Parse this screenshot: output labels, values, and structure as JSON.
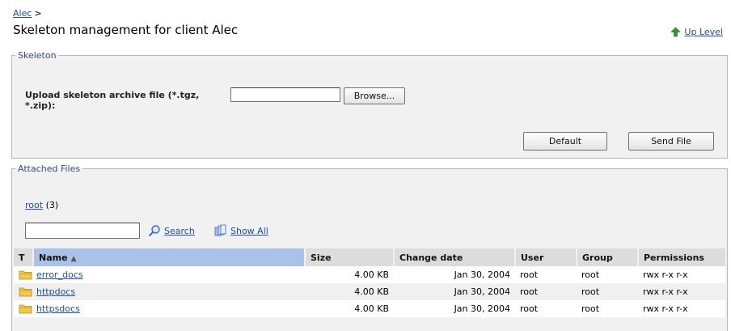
{
  "breadcrumb": {
    "link": "Alec",
    "separator": ">"
  },
  "page_title": "Skeleton management for client Alec",
  "up_level_label": "Up Level",
  "skeleton": {
    "legend": "Skeleton",
    "upload_label": "Upload skeleton archive file (*.tgz, *.zip):",
    "file_value": "",
    "browse_label": "Browse...",
    "default_label": "Default",
    "send_file_label": "Send File"
  },
  "attached": {
    "legend": "Attached Files",
    "root_link": "root",
    "root_count": "(3)",
    "search_value": "",
    "search_label": "Search",
    "show_all_label": "Show All",
    "columns": {
      "type": "T",
      "name": "Name",
      "size": "Size",
      "change_date": "Change date",
      "user": "User",
      "group": "Group",
      "permissions": "Permissions"
    },
    "rows": [
      {
        "name": "error_docs",
        "size": "4.00 KB",
        "date": "Jan 30, 2004",
        "user": "root",
        "group": "root",
        "perms": "rwx r-x r-x"
      },
      {
        "name": "httpdocs",
        "size": "4.00 KB",
        "date": "Jan 30, 2004",
        "user": "root",
        "group": "root",
        "perms": "rwx r-x r-x"
      },
      {
        "name": "httpsdocs",
        "size": "4.00 KB",
        "date": "Jan 30, 2004",
        "user": "root",
        "group": "root",
        "perms": "rwx r-x r-x"
      }
    ]
  },
  "icons": {
    "up_level": "up-arrow-icon",
    "search": "magnifier-icon",
    "show_all": "show-all-icon",
    "folder": "folder-icon",
    "sort": "sort-ascending-icon"
  },
  "colors": {
    "link": "#1f4ea0",
    "panel_bg": "#f1f1f1",
    "header_bg": "#dcdcdc",
    "sorted_header_bg": "#a9c2e8",
    "up_arrow": "#2e9a2e",
    "folder": "#f2c94c"
  }
}
